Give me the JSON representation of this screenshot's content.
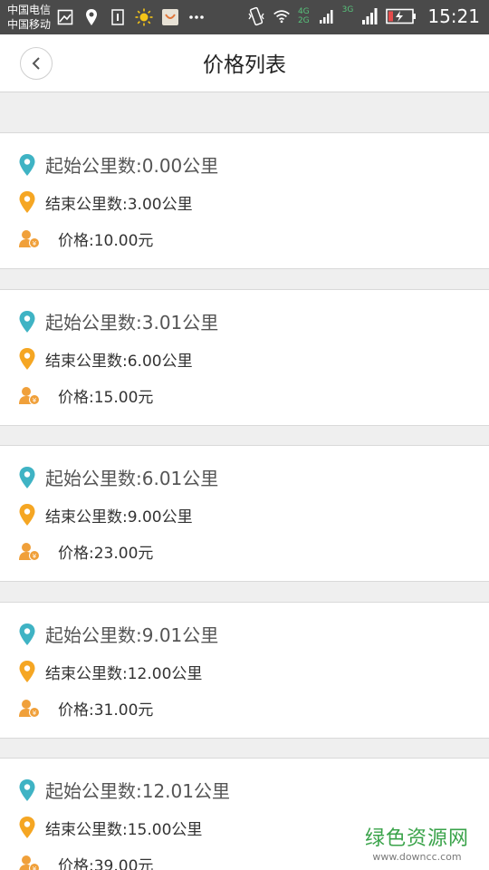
{
  "status_bar": {
    "carrier_1": "中国电信",
    "carrier_2": "中国移动",
    "net_top": "4G",
    "net_bottom": "2G",
    "net_3g": "3G",
    "time": "15:21",
    "icons": [
      "image-icon",
      "location-icon",
      "sim-icon",
      "sun-icon",
      "app-icon",
      "more-icon",
      "vibrate-icon",
      "wifi-icon",
      "signal-icon",
      "signal-icon",
      "battery-charging-icon"
    ]
  },
  "nav": {
    "title": "价格列表",
    "back_icon": "chevron-left-icon"
  },
  "items": [
    {
      "start": "起始公里数:0.00公里",
      "end": "结束公里数:3.00公里",
      "price": "价格:10.00元"
    },
    {
      "start": "起始公里数:3.01公里",
      "end": "结束公里数:6.00公里",
      "price": "价格:15.00元"
    },
    {
      "start": "起始公里数:6.01公里",
      "end": "结束公里数:9.00公里",
      "price": "价格:23.00元"
    },
    {
      "start": "起始公里数:9.01公里",
      "end": "结束公里数:12.00公里",
      "price": "价格:31.00元"
    },
    {
      "start": "起始公里数:12.01公里",
      "end": "结束公里数:15.00公里",
      "price": "价格:39.00元"
    }
  ],
  "colors": {
    "start_pin": "#3fb3c4",
    "end_pin": "#f5a623",
    "price_icon": "#f0a03a"
  },
  "watermark": {
    "title": "绿色资源网",
    "url": "www.downcc.com"
  }
}
